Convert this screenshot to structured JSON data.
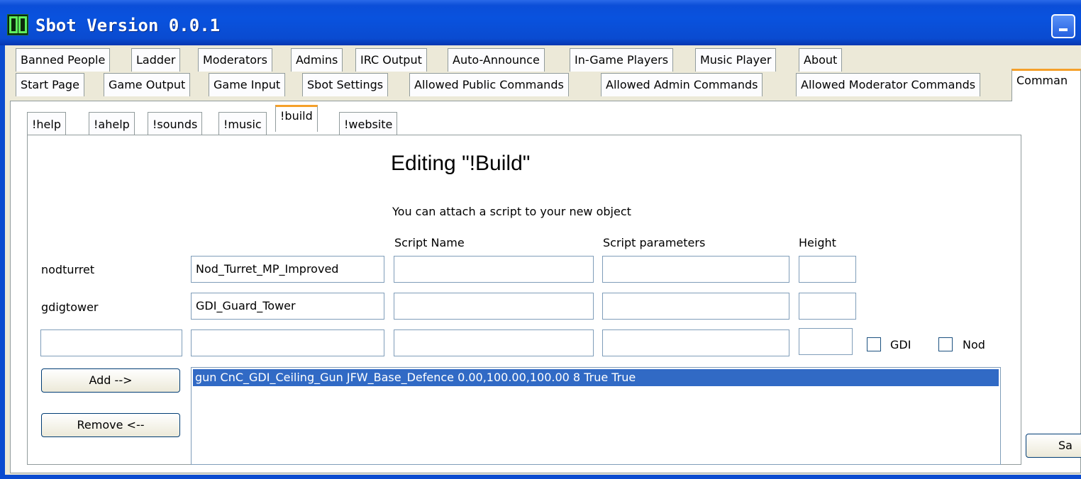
{
  "window": {
    "title": "Sbot Version 0.0.1",
    "icon": "sb-app-icon",
    "accent_color": "#0a4bd0"
  },
  "tabs_row1": [
    "Banned People",
    "Ladder",
    "Moderators",
    "Admins",
    "IRC Output",
    "Auto-Announce",
    "In-Game Players",
    "Music Player",
    "About"
  ],
  "tabs_row2": [
    "Start Page",
    "Game Output",
    "Game Input",
    "Sbot Settings",
    "Allowed Public Commands",
    "Allowed Admin Commands",
    "Allowed Moderator Commands",
    "Comman"
  ],
  "active_tab": "Comman",
  "command_tabs": [
    "!help",
    "!ahelp",
    "!sounds",
    "!music",
    "!build",
    "!website"
  ],
  "active_command_tab": "!build",
  "editor": {
    "heading": "Editing \"!Build\"",
    "script_hint": "You can attach a script to your new object",
    "col_script_name": "Script Name",
    "col_script_params": "Script parameters",
    "col_height": "Height",
    "rows": [
      {
        "label": "nodturret",
        "preset": "Nod_Turret_MP_Improved",
        "script_name": "",
        "script_params": "",
        "height": ""
      },
      {
        "label": "gdigtower",
        "preset": "GDI_Guard_Tower",
        "script_name": "",
        "script_params": "",
        "height": ""
      }
    ],
    "new_row": {
      "name": "",
      "preset": "",
      "script_name": "",
      "script_params": "",
      "height": ""
    },
    "gdi_label": "GDI",
    "nod_label": "Nod",
    "gdi_checked": false,
    "nod_checked": false,
    "add_button": "Add -->",
    "remove_button": "Remove <--",
    "list_items": [
      "gun CnC_GDI_Ceiling_Gun JFW_Base_Defence 0.00,100.00,100.00 8 True True"
    ],
    "selected_color": "#316ac5"
  },
  "save_button": "Sa"
}
